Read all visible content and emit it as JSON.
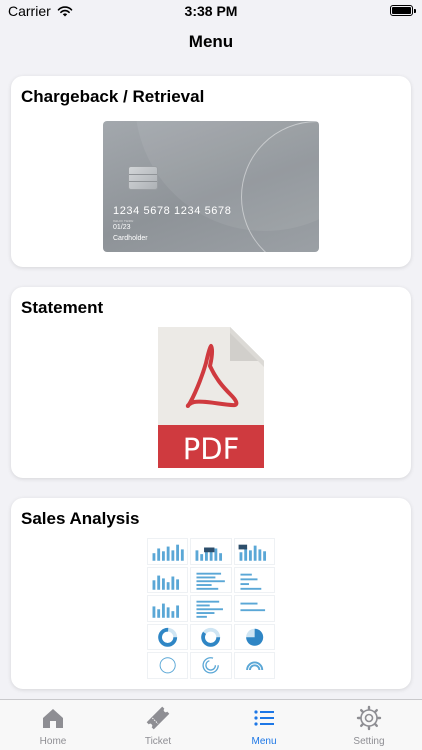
{
  "status_bar": {
    "carrier": "Carrier",
    "time": "3:38 PM"
  },
  "nav": {
    "title": "Menu"
  },
  "cards": [
    {
      "title": "Chargeback / Retrieval",
      "card_number": "1234 5678 1234 5678",
      "valid_label": "VALID THRU",
      "expiry": "01/23",
      "holder": "Cardholder"
    },
    {
      "title": "Statement",
      "pdf_label": "PDF"
    },
    {
      "title": "Sales Analysis"
    }
  ],
  "tabs": [
    {
      "label": "Home",
      "icon": "home-icon"
    },
    {
      "label": "Ticket",
      "icon": "ticket-icon"
    },
    {
      "label": "Menu",
      "icon": "list-icon"
    },
    {
      "label": "Setting",
      "icon": "gear-icon"
    }
  ],
  "colors": {
    "accent": "#1d77e6",
    "pdf_red": "#cf3a3f",
    "inactive": "#8e8e93"
  }
}
